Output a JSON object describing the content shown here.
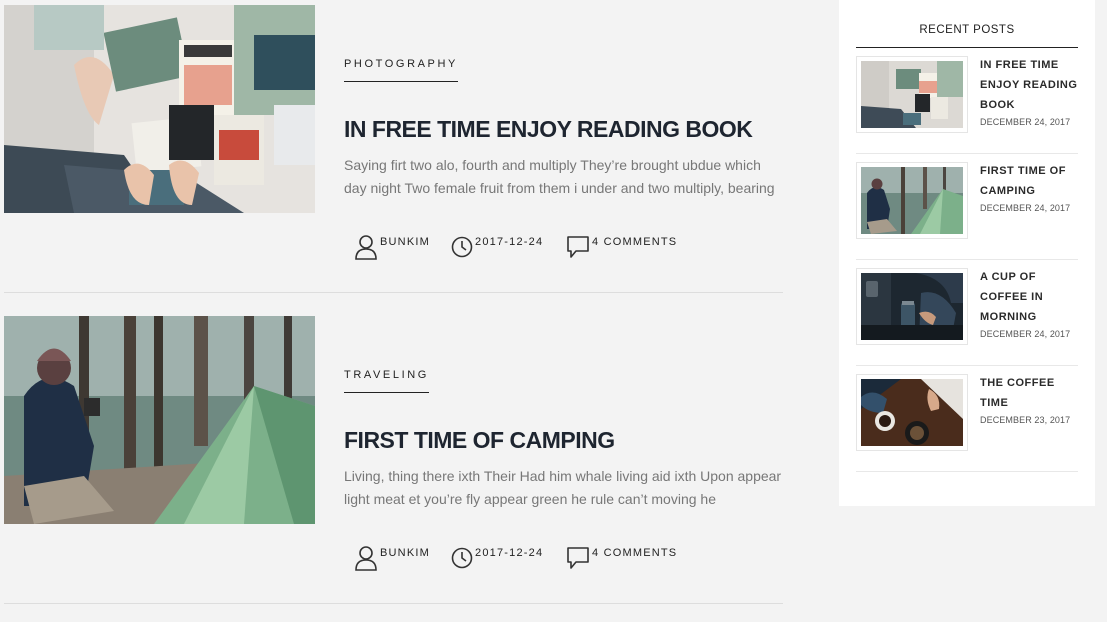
{
  "posts": [
    {
      "category": "PHOTOGRAPHY",
      "title": "IN FREE TIME ENJOY READING BOOK",
      "excerpt": "Saying firt two alo, fourth and multiply They’re brought ubdue which day night Two female fruit from them i under and two multiply, bearing",
      "author": "BUNKIM",
      "date": "2017-12-24",
      "comments": "4 COMMENTS",
      "image": "reading-book-magazines"
    },
    {
      "category": "TRAVELING",
      "title": "FIRST TIME OF CAMPING",
      "excerpt": "Living, thing there ixth Their Had him whale living aid ixth Upon appear light meat et you’re fly appear green he rule can’t moving he",
      "author": "BUNKIM",
      "date": "2017-12-24",
      "comments": "4 COMMENTS",
      "image": "camping-tent-forest"
    }
  ],
  "sidebar": {
    "widget_title": "RECENT POSTS",
    "items": [
      {
        "title": "IN FREE TIME ENJOY READING BOOK",
        "date": "DECEMBER 24, 2017",
        "image": "reading-book-thumb"
      },
      {
        "title": "FIRST TIME OF CAMPING",
        "date": "DECEMBER 24, 2017",
        "image": "camping-thumb"
      },
      {
        "title": "A CUP OF COFFEE IN MORNING",
        "date": "DECEMBER 24, 2017",
        "image": "coffee-jar-thumb"
      },
      {
        "title": "THE COFFEE TIME",
        "date": "DECEMBER 23, 2017",
        "image": "coffee-table-thumb"
      }
    ]
  }
}
